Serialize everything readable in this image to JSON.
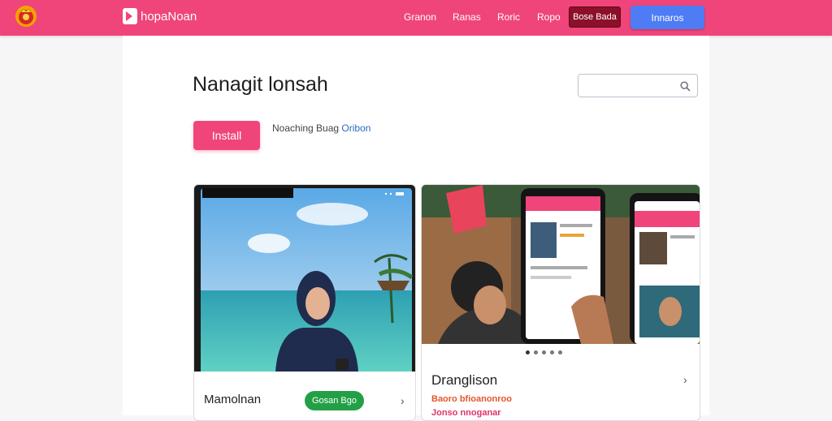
{
  "header": {
    "brand_name": "hopaNoan",
    "nav_items": [
      "Granon",
      "Ranas",
      "Roric",
      "Ropo"
    ],
    "action_dark_label": "Bose Bada",
    "action_primary_label": "Innaros"
  },
  "main": {
    "title": "Nanagit lonsah",
    "search": {
      "placeholder": "",
      "value": ""
    },
    "install_label": "Install",
    "meta_text": "Noaching Buag",
    "meta_accent": "Oribon"
  },
  "cards": [
    {
      "title": "Mamolnan",
      "button_label": "Gosan Bgo"
    },
    {
      "title": "Dranglison",
      "promo_line1": "Baoro bfioanonroo",
      "promo_line2": "Jonso nnoganar"
    }
  ],
  "carousel": {
    "slides": 5,
    "active": 0
  },
  "colors": {
    "header": "#f0457a",
    "accent_dark": "#8c1029",
    "accent_blue": "#4e7cf5",
    "get_button": "#23a046"
  }
}
